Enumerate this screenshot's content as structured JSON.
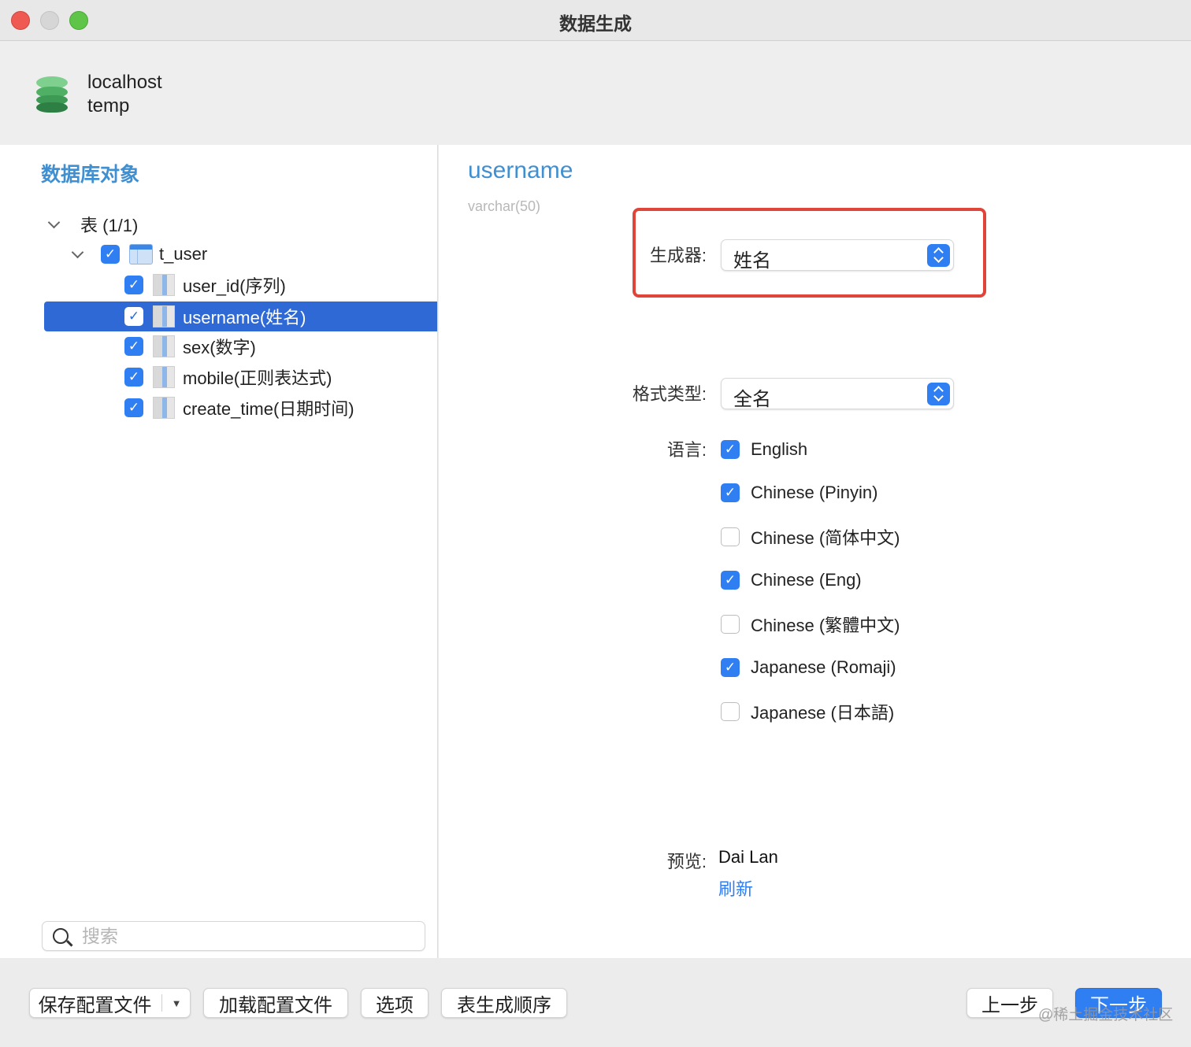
{
  "window": {
    "title": "数据生成"
  },
  "connection": {
    "host": "localhost",
    "database": "temp"
  },
  "left": {
    "section_title": "数据库对象",
    "tree": {
      "group_label": "表 (1/1)",
      "table": {
        "label": "t_user",
        "checked": true
      },
      "columns": [
        {
          "label": "user_id(序列)",
          "checked": true,
          "selected": false
        },
        {
          "label": "username(姓名)",
          "checked": true,
          "selected": true
        },
        {
          "label": "sex(数字)",
          "checked": true,
          "selected": false
        },
        {
          "label": "mobile(正则表达式)",
          "checked": true,
          "selected": false
        },
        {
          "label": "create_time(日期时间)",
          "checked": true,
          "selected": false
        }
      ]
    },
    "search": {
      "placeholder": "搜索"
    }
  },
  "detail": {
    "field_name": "username",
    "field_type": "varchar(50)",
    "generator_label": "生成器:",
    "generator_value": "姓名",
    "format_label": "格式类型:",
    "format_value": "全名",
    "language_label": "语言:",
    "languages": [
      {
        "label": "English",
        "checked": true
      },
      {
        "label": "Chinese (Pinyin)",
        "checked": true
      },
      {
        "label": "Chinese (简体中文)",
        "checked": false
      },
      {
        "label": "Chinese (Eng)",
        "checked": true
      },
      {
        "label": "Chinese (繁體中文)",
        "checked": false
      },
      {
        "label": "Japanese (Romaji)",
        "checked": true
      },
      {
        "label": "Japanese (日本語)",
        "checked": false
      }
    ],
    "preview_label": "预览:",
    "preview_value": "Dai Lan",
    "refresh_label": "刷新"
  },
  "footer": {
    "save_profile": "保存配置文件",
    "load_profile": "加载配置文件",
    "options": "选项",
    "table_order": "表生成顺序",
    "back": "上一步",
    "next": "下一步"
  },
  "watermark": "@稀土掘金技术社区",
  "colors": {
    "accent": "#2f7ef2",
    "selection": "#2e69d6",
    "title_blue": "#3f8fd1",
    "highlight_red": "#e0453a"
  }
}
